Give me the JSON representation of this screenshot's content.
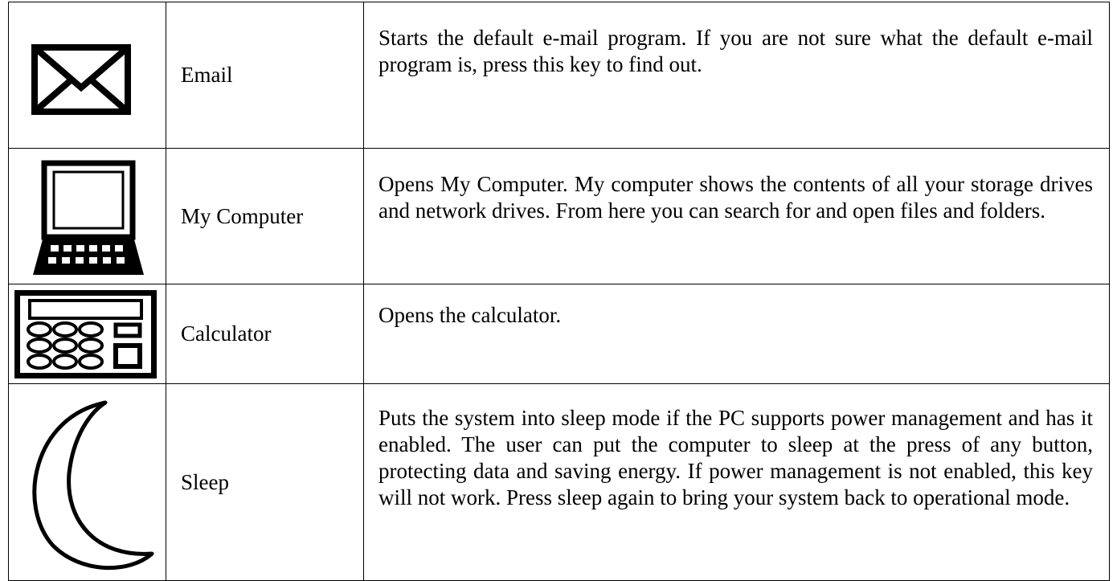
{
  "rows": [
    {
      "icon": "envelope-icon",
      "name": "Email",
      "description": "Starts the default e-mail program. If you are not sure what the default e-mail program is, press this key to find out."
    },
    {
      "icon": "laptop-icon",
      "name": "My Computer",
      "description": "Opens My Computer. My computer shows the contents of all your storage drives and network drives. From here you can search for and open files and folders."
    },
    {
      "icon": "calculator-icon",
      "name": "Calculator",
      "description": "Opens the calculator."
    },
    {
      "icon": "crescent-moon-icon",
      "name": "Sleep",
      "description": "Puts the system into sleep mode if the PC supports power management and has it enabled. The user can put the computer to sleep at the press of any button, protecting data and saving energy. If power management is not enabled, this key will not work. Press sleep again to bring your system back to operational mode."
    }
  ]
}
